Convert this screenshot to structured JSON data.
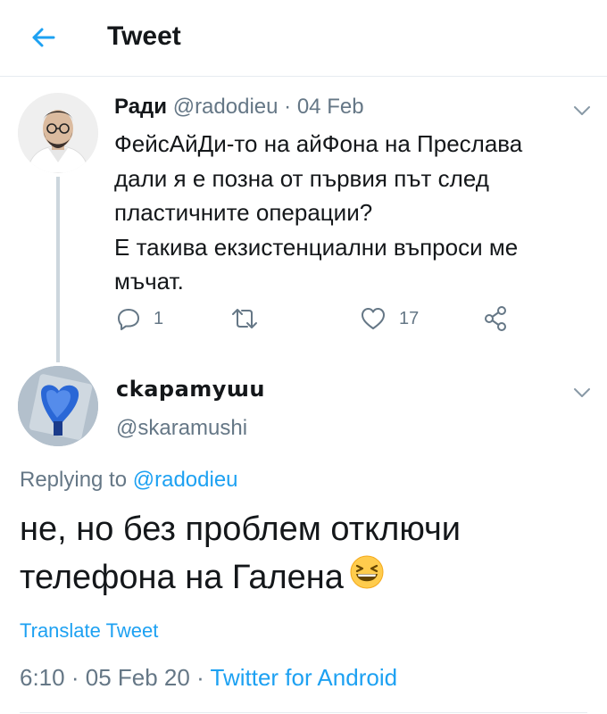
{
  "header": {
    "title": "Tweet",
    "back_icon": "arrow-left-icon",
    "accent": "#1da1f2"
  },
  "parent_tweet": {
    "name": "Ради",
    "handle": "@radodieu",
    "separator": "·",
    "date": "04 Feb",
    "text_lines": [
      "ФейсАйДи-то на айФона на Преслава",
      "дали я е позна от първия път след",
      "пластичните операции?",
      "Е такива екзистенциални въпроси ме",
      "мъчат."
    ],
    "replies": "1",
    "likes": "17"
  },
  "reply_tweet": {
    "name": "ckapamyɯu",
    "handle": "@skaramushi",
    "replying_prefix": "Replying to",
    "replying_to": "@radodieu",
    "text_lines": [
      "не, но без проблем отключи",
      "телефона на Галена"
    ],
    "emoji": "grinning-squinting-face",
    "translate_label": "Translate Tweet",
    "time": "6:10",
    "separator": "·",
    "date": "05 Feb 20",
    "source": "Twitter for Android"
  },
  "colors": {
    "text": "#14171a",
    "muted": "#657786",
    "link": "#1da1f2",
    "border": "#e6ecf0"
  }
}
